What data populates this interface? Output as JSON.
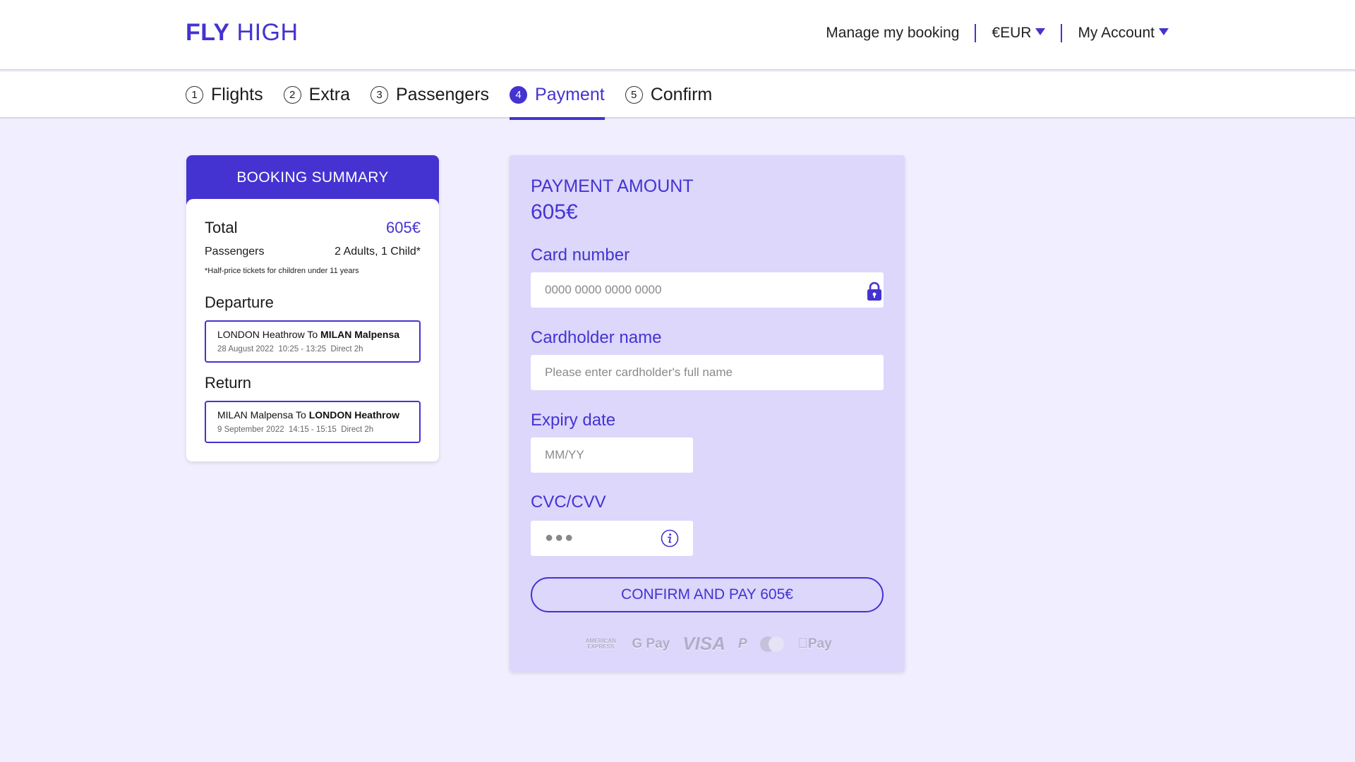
{
  "header": {
    "logo_bold": "FLY",
    "logo_rest": "HIGH",
    "manage_booking": "Manage my booking",
    "currency": "€EUR",
    "account": "My Account"
  },
  "steps": [
    {
      "num": "1",
      "label": "Flights"
    },
    {
      "num": "2",
      "label": "Extra"
    },
    {
      "num": "3",
      "label": "Passengers"
    },
    {
      "num": "4",
      "label": "Payment",
      "active": true
    },
    {
      "num": "5",
      "label": "Confirm"
    }
  ],
  "summary": {
    "title": "BOOKING SUMMARY",
    "total_label": "Total",
    "total_value": "605€",
    "passengers_label": "Passengers",
    "passengers_value": "2 Adults, 1 Child*",
    "note": "*Half-price tickets for children under 11 years",
    "departure": {
      "title": "Departure",
      "from": "LONDON Heathrow",
      "to_word": "To",
      "to": "MILAN Malpensa",
      "date": "28 August 2022",
      "time": "10:25 - 13:25",
      "type": "Direct 2h"
    },
    "return": {
      "title": "Return",
      "from": "MILAN Malpensa",
      "to_word": "To",
      "to": "LONDON Heathrow",
      "date": "9 September 2022",
      "time": "14:15 - 15:15",
      "type": "Direct 2h"
    }
  },
  "payment": {
    "amount_label": "PAYMENT AMOUNT",
    "amount_value": "605€",
    "card_number_label": "Card number",
    "card_number_placeholder": "0000 0000 0000 0000",
    "cardholder_label": "Cardholder name",
    "cardholder_placeholder": "Please enter cardholder's full name",
    "expiry_label": "Expiry date",
    "expiry_placeholder": "MM/YY",
    "cvc_label": "CVC/CVV",
    "cvc_placeholder": "●●●",
    "confirm_button": "CONFIRM AND PAY 605€",
    "logos": {
      "amex": "AMERICAN EXPRESS",
      "gpay": "G Pay",
      "visa": "VISA",
      "paypal": "P",
      "applepay": "Pay"
    }
  },
  "colors": {
    "accent": "#4433d1",
    "page_bg": "#f1efff",
    "payment_bg": "#dcd7fb"
  }
}
